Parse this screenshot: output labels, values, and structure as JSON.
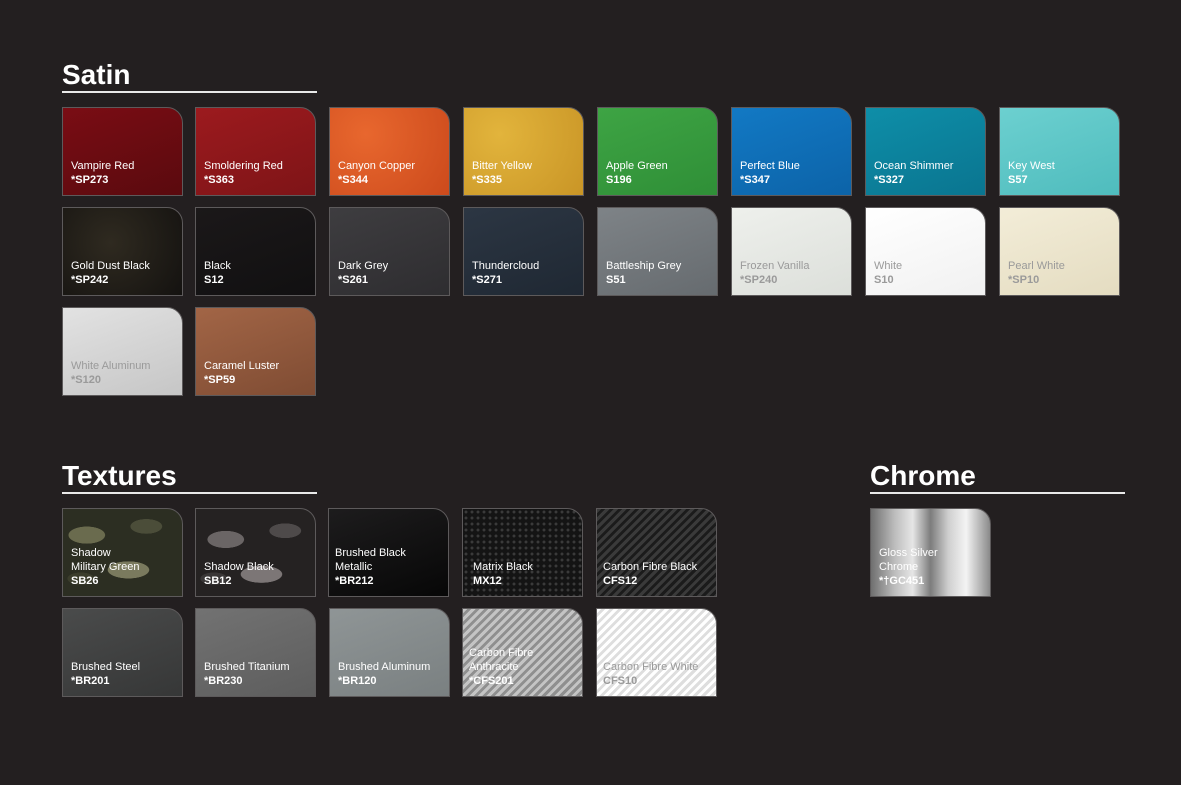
{
  "sections": {
    "satin": {
      "title": "Satin"
    },
    "textures": {
      "title": "Textures"
    },
    "chrome": {
      "title": "Chrome"
    }
  },
  "satin_swatches": [
    {
      "name": "Vampire Red",
      "code": "*SP273",
      "color": "#7a0d14"
    },
    {
      "name": "Smoldering Red",
      "code": "*S363",
      "color": "#9c1a1e"
    },
    {
      "name": "Canyon Copper",
      "code": "*S344",
      "color": "#e0602a"
    },
    {
      "name": "Bitter Yellow",
      "code": "*S335",
      "color": "#dca834"
    },
    {
      "name": "Apple Green",
      "code": "S196",
      "color": "#3ea444"
    },
    {
      "name": "Perfect Blue",
      "code": "*S347",
      "color": "#1279c4"
    },
    {
      "name": "Ocean Shimmer",
      "code": "*S327",
      "color": "#0e8ea8"
    },
    {
      "name": "Key West",
      "code": "S57",
      "color": "#6cd0d0"
    },
    {
      "name": "Gold Dust Black",
      "code": "*SP242",
      "color": "#1f1c17"
    },
    {
      "name": "Black",
      "code": "S12",
      "color": "#161415"
    },
    {
      "name": "Dark Grey",
      "code": "*S261",
      "color": "#37363a"
    },
    {
      "name": "Thundercloud",
      "code": "*S271",
      "color": "#27313d"
    },
    {
      "name": "Battleship Grey",
      "code": "S51",
      "color": "#777c80"
    },
    {
      "name": "Frozen Vanilla",
      "code": "*SP240",
      "color": "#e8eae6"
    },
    {
      "name": "White",
      "code": "S10",
      "color": "#ffffff"
    },
    {
      "name": "Pearl White",
      "code": "*SP10",
      "color": "#efe8d2"
    },
    {
      "name": "White Aluminum",
      "code": "*S120",
      "color": "#d8d8d8"
    },
    {
      "name": "Caramel Luster",
      "code": "*SP59",
      "color": "#95603f"
    }
  ],
  "texture_swatches": [
    {
      "name": "Shadow\nMilitary Green",
      "code": "SB26"
    },
    {
      "name": "Shadow Black",
      "code": "SB12"
    },
    {
      "name": "Brushed Black\nMetallic",
      "code": "*BR212"
    },
    {
      "name": "Matrix Black",
      "code": "MX12"
    },
    {
      "name": "Carbon Fibre Black",
      "code": "CFS12"
    },
    {
      "name": "Brushed Steel",
      "code": "*BR201"
    },
    {
      "name": "Brushed Titanium",
      "code": "*BR230"
    },
    {
      "name": "Brushed Aluminum",
      "code": "*BR120"
    },
    {
      "name": "Carbon Fibre\nAnthracite",
      "code": "*CFS201"
    },
    {
      "name": "Carbon Fibre White",
      "code": "CFS10"
    }
  ],
  "chrome_swatches": [
    {
      "name": "Gloss Silver\nChrome",
      "code": "*†GC451"
    }
  ]
}
